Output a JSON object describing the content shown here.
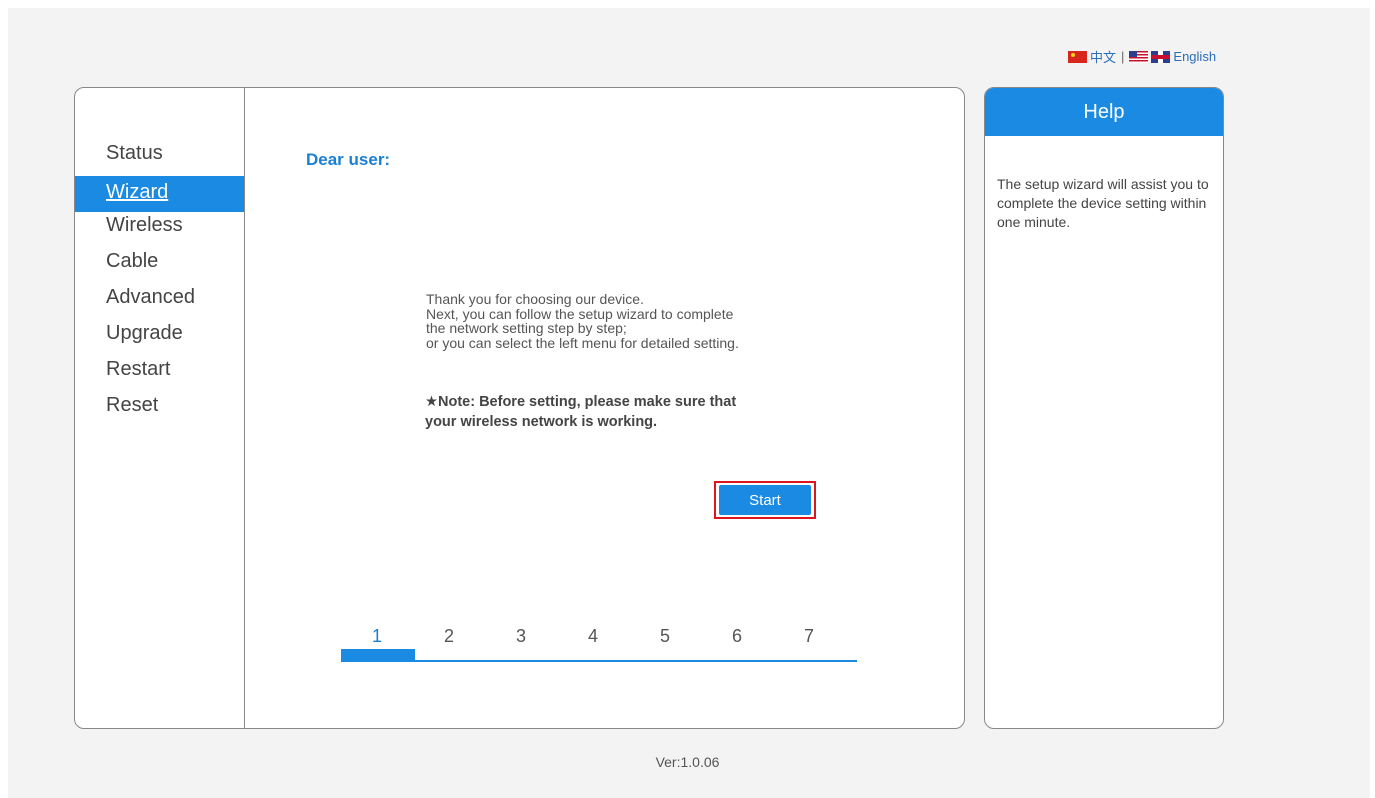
{
  "language": {
    "chinese_label": "中文",
    "separator": "|",
    "english_label": "English"
  },
  "sidebar": {
    "items": [
      {
        "label": "Status"
      },
      {
        "label": "Wizard"
      },
      {
        "label": "Wireless"
      },
      {
        "label": "Cable"
      },
      {
        "label": "Advanced"
      },
      {
        "label": "Upgrade"
      },
      {
        "label": "Restart"
      },
      {
        "label": "Reset"
      }
    ],
    "active_index": 1
  },
  "main": {
    "greeting": "Dear user:",
    "intro_lines": [
      "Thank you for choosing our device.",
      "Next, you can follow the setup wizard to complete",
      "the network setting step by step;",
      "or you can select the left menu for detailed setting."
    ],
    "note_line1": "★Note: Before setting, please make sure that",
    "note_line2": "your wireless network is working.",
    "start_label": "Start"
  },
  "steps": {
    "labels": [
      "1",
      "2",
      "3",
      "4",
      "5",
      "6",
      "7"
    ],
    "current": 1,
    "total": 7
  },
  "help": {
    "title": "Help",
    "text": "The setup wizard will assist you to complete the device setting within one minute."
  },
  "footer": {
    "version": "Ver:1.0.06"
  },
  "colors": {
    "accent": "#1b8ae3",
    "highlight_border": "#e0141c",
    "background": "#f3f3f3"
  }
}
